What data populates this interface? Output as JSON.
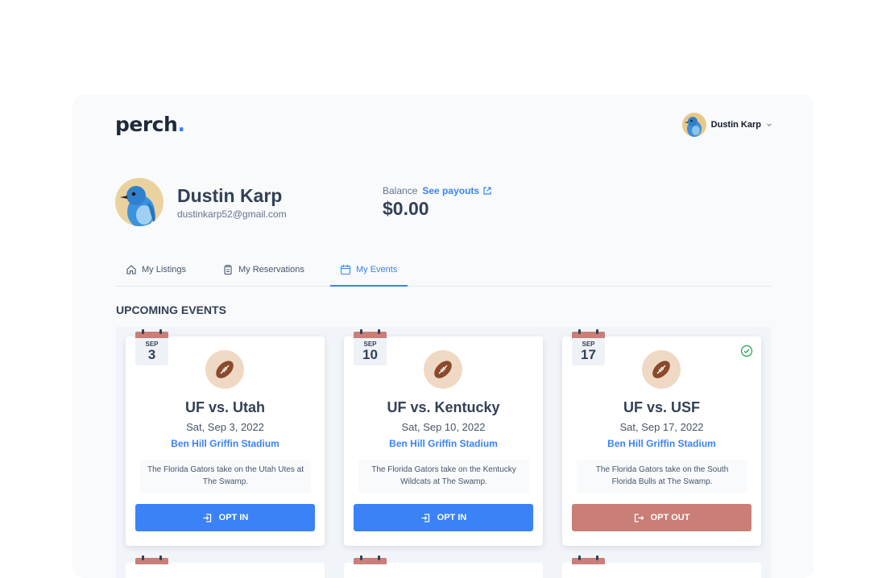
{
  "logo": {
    "text": "perch",
    "dot": "."
  },
  "user_menu": {
    "name": "Dustin Karp"
  },
  "profile": {
    "name": "Dustin Karp",
    "email": "dustinkarp52@gmail.com"
  },
  "balance": {
    "label": "Balance",
    "link": "See payouts",
    "amount": "$0.00"
  },
  "tabs": [
    {
      "label": "My Listings",
      "icon": "home-icon"
    },
    {
      "label": "My Reservations",
      "icon": "clipboard-icon"
    },
    {
      "label": "My Events",
      "icon": "calendar-icon",
      "active": true
    }
  ],
  "section_title": "UPCOMING EVENTS",
  "events": [
    {
      "month": "SEP",
      "day": "3",
      "title": "UF vs. Utah",
      "date": "Sat, Sep 3, 2022",
      "venue": "Ben Hill Griffin Stadium",
      "description": "The Florida Gators take on the Utah Utes at The Swamp.",
      "button": "OPT IN",
      "opted_in": false
    },
    {
      "month": "SEP",
      "day": "10",
      "title": "UF vs. Kentucky",
      "date": "Sat, Sep 10, 2022",
      "venue": "Ben Hill Griffin Stadium",
      "description": "The Florida Gators take on the Kentucky Wildcats at The Swamp.",
      "button": "OPT IN",
      "opted_in": false
    },
    {
      "month": "SEP",
      "day": "17",
      "title": "UF vs. USF",
      "date": "Sat, Sep 17, 2022",
      "venue": "Ben Hill Griffin Stadium",
      "description": "The Florida Gators take on the South Florida Bulls at The Swamp.",
      "button": "OPT OUT",
      "opted_in": true
    }
  ],
  "colors": {
    "accent": "#3b82f6",
    "opt_out": "#c97e77",
    "check": "#16a34a"
  }
}
